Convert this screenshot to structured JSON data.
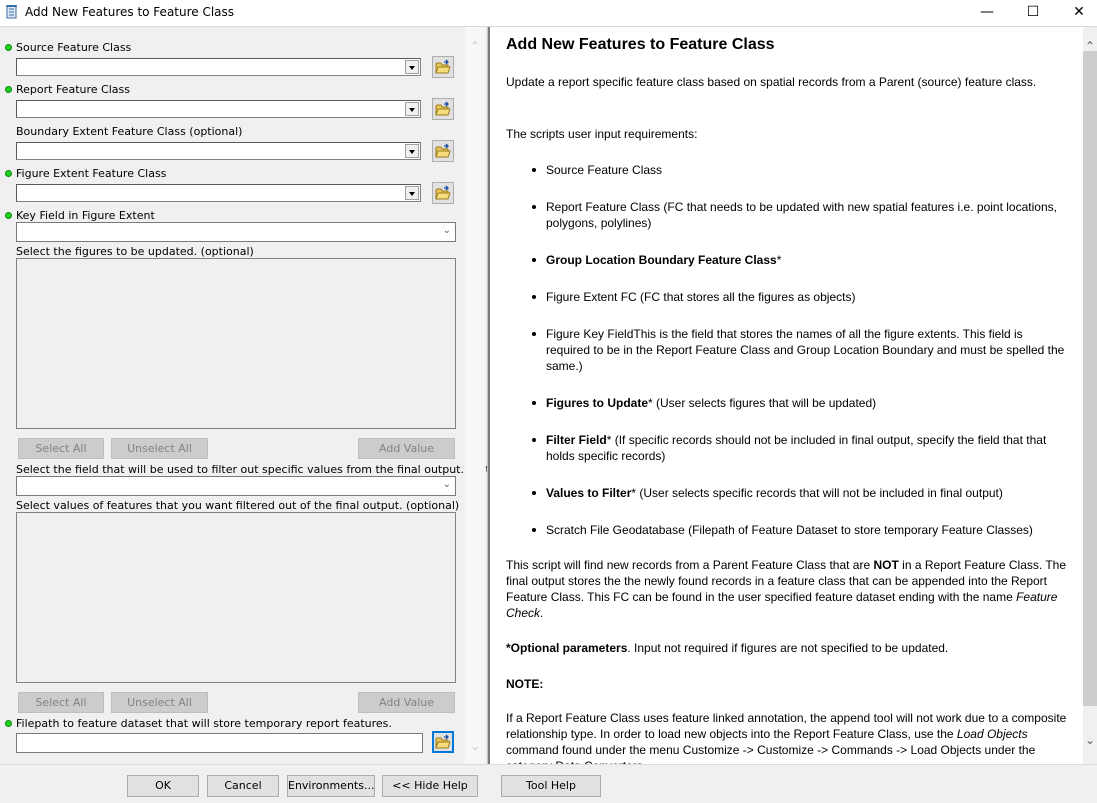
{
  "window": {
    "title": "Add New Features to Feature Class",
    "icon": "script-tool-icon",
    "controls": {
      "minimize": "—",
      "maximize": "☐",
      "close": "✕"
    }
  },
  "params": {
    "source_fc": {
      "label": "Source Feature Class",
      "required": true,
      "value": ""
    },
    "report_fc": {
      "label": "Report Feature Class",
      "required": true,
      "value": ""
    },
    "boundary_fc": {
      "label": "Boundary Extent Feature Class (optional)",
      "required": false,
      "value": ""
    },
    "figure_fc": {
      "label": "Figure Extent Feature Class",
      "required": true,
      "value": ""
    },
    "key_field": {
      "label": "Key Field in Figure Extent",
      "required": true,
      "value": ""
    },
    "figures_list": {
      "label": "Select the figures to be updated. (optional)"
    },
    "filter_field": {
      "label": "Select the field that will be used to filter out specific values from the final output. (optional)",
      "value": ""
    },
    "filter_values": {
      "label": "Select values of features that you want filtered out of the final output. (optional)"
    },
    "filepath": {
      "label": "Filepath to feature dataset that will store temporary report features.",
      "required": true,
      "value": ""
    }
  },
  "list_buttons": {
    "select_all": "Select All",
    "unselect_all": "Unselect All",
    "add_value": "Add Value"
  },
  "help": {
    "title": "Add New Features to Feature Class",
    "intro": "Update a report specific feature class based on spatial records from a Parent (source) feature class.",
    "requirements_heading": "The scripts user input requirements:",
    "bullets": [
      {
        "bold": "",
        "text": "Source Feature Class"
      },
      {
        "bold": "",
        "text": "Report Feature Class (FC that needs to be updated with new spatial features i.e. point locations, polygons, polylines)"
      },
      {
        "bold": "Group Location Boundary Feature Class",
        "text": "*"
      },
      {
        "bold": "",
        "text": "Figure Extent FC (FC that stores all the figures as objects)"
      },
      {
        "bold": "",
        "text": "Figure Key FieldThis is the field that stores the names of all the figure extents. This field is required to be in the Report Feature Class and Group Location Boundary and must be spelled the same.)"
      },
      {
        "bold": "Figures to Update",
        "text": "* (User selects figures that will be updated)"
      },
      {
        "bold": "Filter Field",
        "text": "* (If specific records should not be included in final output, specify the field that that holds specific records)"
      },
      {
        "bold": "Values to Filter",
        "text": "* (User selects specific records that will not be included in final output)"
      },
      {
        "bold": "",
        "text": "Scratch File Geodatabase (Filepath of Feature Dataset to store temporary Feature Classes)"
      }
    ],
    "summary_pre": "This script will find new records from a Parent Feature Class that are ",
    "summary_bold": "NOT",
    "summary_mid": " in a Report Feature Class. The final output stores the the newly found records in a feature class that can be appended into the Report Feature Class. This FC can be found in the user specified feature dataset ending with the name ",
    "summary_italic": "Feature Check",
    "summary_end": ".",
    "optional_bold": "*Optional parameters",
    "optional_text": ". Input not required if figures are not specified to be updated.",
    "note_heading": "NOTE:",
    "note_pre": "If a Report Feature Class uses feature linked annotation, the append tool will not work due to a composite relationship type. In order to load new objects into the Report Feature Class, use the ",
    "note_italic": "Load Objects",
    "note_post": " command found under the menu Customize -> Customize -> Commands -> Load Objects under the category Data Converters"
  },
  "footer": {
    "ok": "OK",
    "cancel": "Cancel",
    "environments": "Environments...",
    "hide_help": "<< Hide Help",
    "tool_help": "Tool Help"
  }
}
